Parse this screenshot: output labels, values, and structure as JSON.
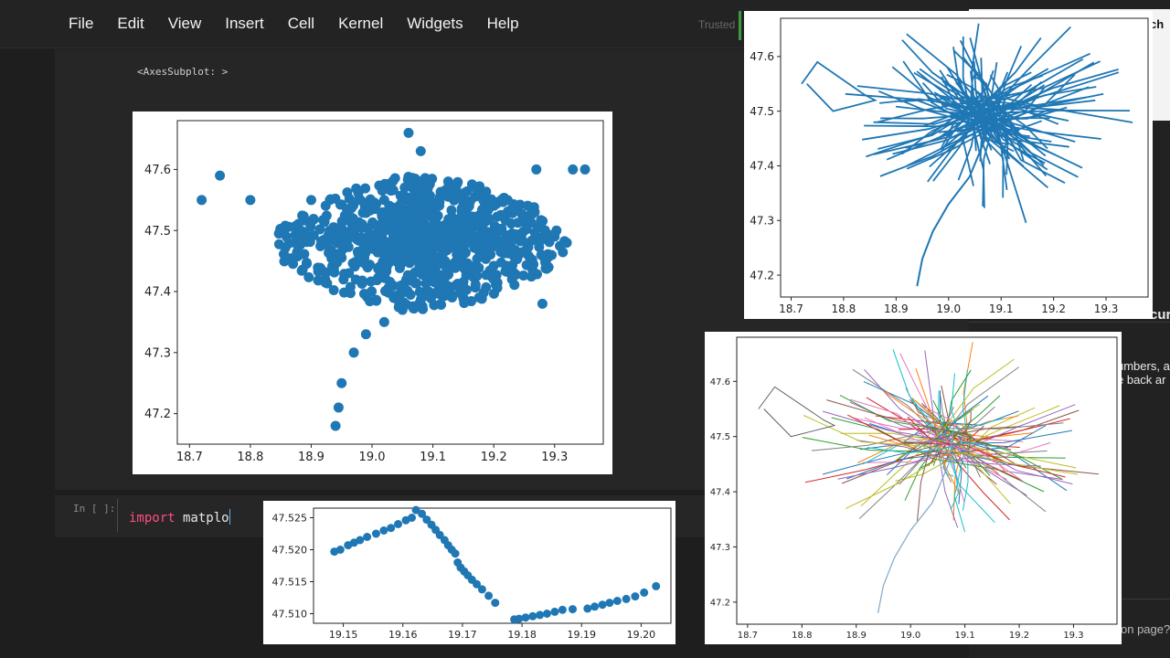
{
  "menu": [
    "File",
    "Edit",
    "View",
    "Insert",
    "Cell",
    "Kernel",
    "Widgets",
    "Help"
  ],
  "status": {
    "trusted": "Trusted"
  },
  "output": {
    "text": "<AxesSubplot: >"
  },
  "input_cell": {
    "prompt": "In [ ]:",
    "keyword": "import",
    "rest": " matplo"
  },
  "right_panel": {
    "t1": "ch",
    "t2": "cur",
    "t3": "umbers, a",
    "t4": "e back ar",
    "t5": "on page?"
  },
  "colors": {
    "point_blue": "#1f77b4",
    "bg": "#1e1e1e"
  },
  "chart_data": [
    {
      "type": "scatter",
      "title": "",
      "xlabel": "",
      "ylabel": "",
      "xlim": [
        18.68,
        19.38
      ],
      "ylim": [
        47.15,
        47.68
      ],
      "xticks": [
        "18.7",
        "18.8",
        "18.9",
        "19.0",
        "19.1",
        "19.2",
        "19.3"
      ],
      "yticks": [
        "47.2",
        "47.3",
        "47.4",
        "47.5",
        "47.6"
      ],
      "grid": false,
      "series": [
        {
          "points": [
            [
              18.94,
              47.18
            ],
            [
              18.945,
              47.21
            ],
            [
              18.95,
              47.25
            ],
            [
              18.97,
              47.3
            ],
            [
              18.99,
              47.33
            ],
            [
              19.02,
              47.35
            ],
            [
              19.05,
              47.37
            ],
            [
              19.06,
              47.66
            ],
            [
              19.08,
              47.63
            ],
            [
              18.72,
              47.55
            ],
            [
              18.75,
              47.59
            ],
            [
              18.8,
              47.55
            ],
            [
              18.85,
              47.5
            ],
            [
              18.88,
              47.46
            ],
            [
              18.9,
              47.55
            ],
            [
              19.3,
              47.49
            ],
            [
              19.32,
              47.48
            ],
            [
              19.35,
              47.6
            ],
            [
              19.33,
              47.6
            ],
            [
              19.27,
              47.6
            ],
            [
              19.28,
              47.38
            ],
            [
              19.23,
              47.42
            ],
            [
              19.15,
              47.39
            ],
            [
              19.05,
              47.5
            ],
            [
              19.1,
              47.52
            ],
            [
              19.12,
              47.45
            ],
            [
              19.0,
              47.47
            ],
            [
              19.02,
              47.55
            ],
            [
              19.15,
              47.55
            ],
            [
              19.2,
              47.5
            ]
          ]
        }
      ]
    },
    {
      "type": "line",
      "title": "",
      "xlabel": "",
      "ylabel": "",
      "xlim": [
        18.68,
        19.38
      ],
      "ylim": [
        47.16,
        47.67
      ],
      "xticks": [
        "18.7",
        "18.8",
        "18.9",
        "19.0",
        "19.1",
        "19.2",
        "19.3"
      ],
      "yticks": [
        "47.2",
        "47.3",
        "47.4",
        "47.5",
        "47.6"
      ],
      "grid": false,
      "series": [
        {
          "points": [
            [
              18.94,
              47.18
            ],
            [
              18.95,
              47.23
            ],
            [
              18.97,
              47.28
            ],
            [
              19.0,
              47.33
            ],
            [
              19.04,
              47.38
            ],
            [
              19.07,
              47.45
            ],
            [
              19.08,
              47.52
            ]
          ]
        }
      ]
    },
    {
      "type": "scatter",
      "title": "",
      "xlabel": "",
      "ylabel": "",
      "xlim": [
        19.145,
        19.205
      ],
      "ylim": [
        47.5085,
        47.5265
      ],
      "xticks": [
        "19.15",
        "19.16",
        "19.17",
        "19.18",
        "19.19",
        "19.20"
      ],
      "yticks": [
        "47.510",
        "47.515",
        "47.520",
        "47.525"
      ],
      "grid": false,
      "series": [
        {
          "points": [
            [
              19.1485,
              47.5197
            ],
            [
              19.1495,
              47.52
            ],
            [
              19.1508,
              47.5207
            ],
            [
              19.1518,
              47.5211
            ],
            [
              19.1528,
              47.5215
            ],
            [
              19.154,
              47.522
            ],
            [
              19.1555,
              47.5225
            ],
            [
              19.1568,
              47.523
            ],
            [
              19.158,
              47.5234
            ],
            [
              19.1592,
              47.524
            ],
            [
              19.1605,
              47.5246
            ],
            [
              19.1615,
              47.525
            ],
            [
              19.1622,
              47.5262
            ],
            [
              19.1632,
              47.5256
            ],
            [
              19.164,
              47.5247
            ],
            [
              19.1648,
              47.5239
            ],
            [
              19.1655,
              47.5231
            ],
            [
              19.1662,
              47.5223
            ],
            [
              19.167,
              47.5215
            ],
            [
              19.1676,
              47.5207
            ],
            [
              19.1682,
              47.52
            ],
            [
              19.1688,
              47.5194
            ],
            [
              19.1692,
              47.518
            ],
            [
              19.1697,
              47.5172
            ],
            [
              19.1703,
              47.5166
            ],
            [
              19.1709,
              47.516
            ],
            [
              19.1716,
              47.5153
            ],
            [
              19.1724,
              47.5146
            ],
            [
              19.1733,
              47.5138
            ],
            [
              19.1744,
              47.5128
            ],
            [
              19.1755,
              47.5117
            ],
            [
              19.1787,
              47.5091
            ],
            [
              19.1795,
              47.5092
            ],
            [
              19.1806,
              47.5094
            ],
            [
              19.1818,
              47.5096
            ],
            [
              19.183,
              47.5098
            ],
            [
              19.1842,
              47.51
            ],
            [
              19.1855,
              47.5103
            ],
            [
              19.1868,
              47.5106
            ],
            [
              19.1885,
              47.5107
            ],
            [
              19.191,
              47.5108
            ],
            [
              19.1922,
              47.5111
            ],
            [
              19.1935,
              47.5114
            ],
            [
              19.1947,
              47.5117
            ],
            [
              19.196,
              47.512
            ],
            [
              19.1975,
              47.5123
            ],
            [
              19.199,
              47.5127
            ],
            [
              19.2005,
              47.5133
            ],
            [
              19.2025,
              47.5143
            ]
          ]
        }
      ]
    },
    {
      "type": "line",
      "title": "",
      "xlabel": "",
      "ylabel": "",
      "xlim": [
        18.68,
        19.38
      ],
      "ylim": [
        47.16,
        47.68
      ],
      "xticks": [
        "18.7",
        "18.8",
        "18.9",
        "19.0",
        "19.1",
        "19.2",
        "19.3"
      ],
      "yticks": [
        "47.2",
        "47.3",
        "47.4",
        "47.5",
        "47.6"
      ],
      "grid": false,
      "series": [
        {
          "points": [
            [
              18.94,
              47.18
            ],
            [
              18.95,
              47.23
            ],
            [
              18.97,
              47.28
            ],
            [
              19.0,
              47.33
            ],
            [
              19.04,
              47.38
            ],
            [
              19.07,
              47.45
            ],
            [
              19.08,
              47.52
            ]
          ]
        }
      ]
    }
  ]
}
